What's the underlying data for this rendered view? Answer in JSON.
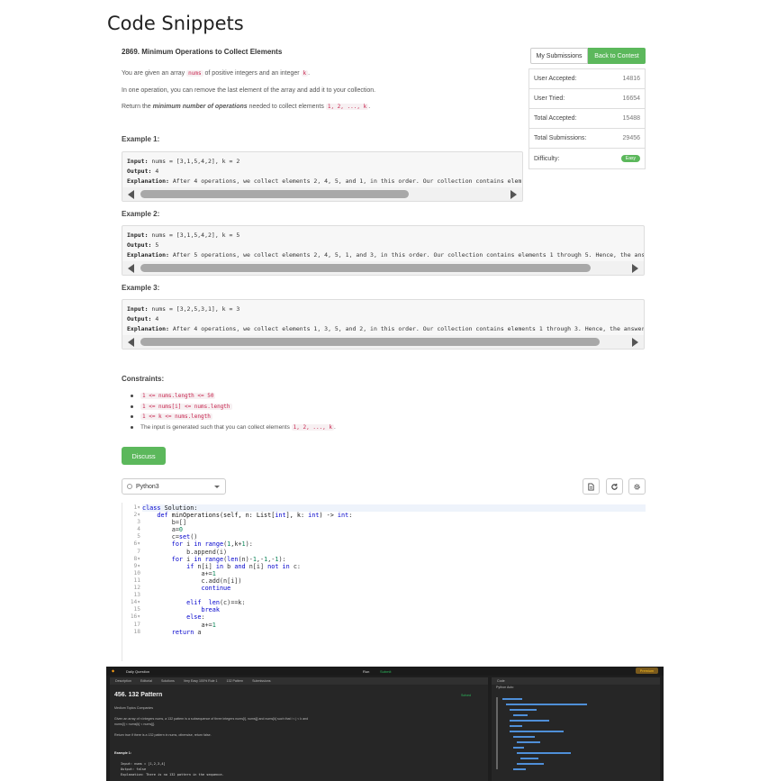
{
  "page_title": "Code Snippets",
  "problem": {
    "title": "2869. Minimum Operations to Collect Elements",
    "p1_a": "You are given an array ",
    "p1_code1": "nums",
    "p1_b": " of positive integers and an integer ",
    "p1_code2": "k",
    "p1_c": ".",
    "p2": "In one operation, you can remove the last element of the array and add it to your collection.",
    "p3_a": "Return the ",
    "p3_bold": "minimum number of operations",
    "p3_b": " needed to collect elements ",
    "p3_code": "1, 2, ..., k",
    "p3_c": "."
  },
  "examples": [
    {
      "label": "Example 1:",
      "input_label": "Input:",
      "input": " nums = [3,1,5,4,2], k = 2",
      "output_label": "Output:",
      "output": " 4",
      "explanation_label": "Explanation:",
      "explanation": " After 4 operations, we collect elements 2, 4, 5, and 1, in this order. Our collection contains elem",
      "scroll_fraction": 0.72
    },
    {
      "label": "Example 2:",
      "input_label": "Input:",
      "input": " nums = [3,1,5,4,2], k = 5",
      "output_label": "Output:",
      "output": " 5",
      "explanation_label": "Explanation:",
      "explanation": " After 5 operations, we collect elements 2, 4, 5, 1, and 3, in this order. Our collection contains elements 1 through 5. Hence, the ans",
      "scroll_fraction": 0.9
    },
    {
      "label": "Example 3:",
      "input_label": "Input:",
      "input": " nums = [3,2,5,3,1], k = 3",
      "output_label": "Output:",
      "output": " 4",
      "explanation_label": "Explanation:",
      "explanation": " After 4 operations, we collect elements 1, 3, 5, and 2, in this order. Our collection contains elements 1 through 3. Hence, the answer",
      "scroll_fraction": 0.96
    }
  ],
  "sidebar": {
    "my_submissions": "My Submissions",
    "back_to_contest": "Back to Contest",
    "stats": [
      {
        "label": "User Accepted:",
        "value": "14816"
      },
      {
        "label": "User Tried:",
        "value": "16654"
      },
      {
        "label": "Total Accepted:",
        "value": "15488"
      },
      {
        "label": "Total Submissions:",
        "value": "29456"
      },
      {
        "label": "Difficulty:",
        "value": "Easy"
      }
    ]
  },
  "constraints": {
    "label": "Constraints:",
    "items": [
      "1 <= nums.length <= 50",
      "1 <= nums[i] <= nums.length",
      "1 <= k <= nums.length"
    ],
    "last_a": "The input is generated such that you can collect elements ",
    "last_code": "1, 2, ..., k",
    "last_b": "."
  },
  "discuss_label": "Discuss",
  "editor": {
    "language": "Python3",
    "line_numbers": [
      "1",
      "2",
      "3",
      "4",
      "5",
      "6",
      "7",
      "8",
      "9",
      "10",
      "11",
      "12",
      "13",
      "14",
      "15",
      "16",
      "17",
      "18"
    ],
    "fold_markers": [
      "1",
      "2",
      "6",
      "8",
      "9",
      "14",
      "16"
    ]
  },
  "embedded_screenshot": {
    "topbar_label": "Daily Question",
    "run": "Run",
    "submit": "Submit",
    "premium": "Premium",
    "tabs": [
      "Description",
      "Editorial",
      "Solutions",
      "Very Easy 100% Rule 1",
      "132 Pattern",
      "Submissions"
    ],
    "solved": "Solved",
    "title": "456. 132 Pattern",
    "tags": "Medium   Topics   Companies",
    "desc1": "Given an array of n integers nums, a 132 pattern is a subsequence of three integers nums[i], nums[j] and nums[k] such that i < j < k and",
    "desc2": "nums[i] < nums[k] < nums[j].",
    "desc3": "Return true if there is a 132 pattern in nums, otherwise, return false.",
    "example": "Example 1:",
    "ex_input": "Input: nums = [1,2,3,4]",
    "ex_output": "Output: false",
    "ex_expl": "Explanation: There is no 132 pattern in the sequence.",
    "code_tab": "Code",
    "code_lang": "Python",
    "code_auto": "Auto"
  }
}
